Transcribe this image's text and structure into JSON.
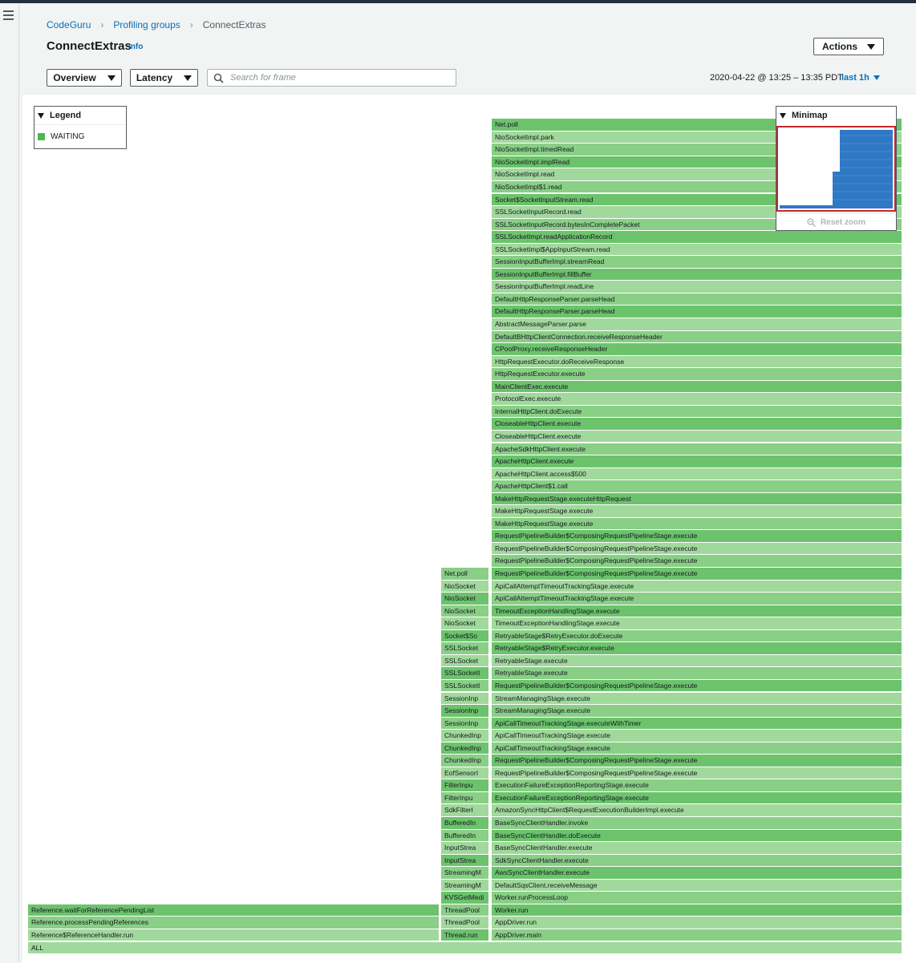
{
  "breadcrumb": {
    "root": "CodeGuru",
    "middle": "Profiling groups",
    "current": "ConnectExtras"
  },
  "page": {
    "title": "ConnectExtras",
    "info": "Info",
    "actions_label": "Actions"
  },
  "toolbar": {
    "view_select": "Overview",
    "metric_select": "Latency",
    "search_placeholder": "Search for frame",
    "time_range": "2020-04-22 @ 13:25 – 13:35 PDT",
    "time_select": "last 1h"
  },
  "legend": {
    "title": "Legend",
    "items": [
      {
        "label": "WAITING",
        "color": "#4fb84d"
      }
    ]
  },
  "minimap": {
    "title": "Minimap",
    "reset_label": "Reset zoom"
  },
  "flamegraph": {
    "colors": {
      "dark": "#6cc36c",
      "mid": "#89cf86",
      "light": "#a1d99c"
    },
    "root": "ALL",
    "left_stack": [
      "Reference$ReferenceHandler.run",
      "Reference.processPendingReferences",
      "Reference.waitForReferencePendingList"
    ],
    "middle_stack": [
      "Thread.run",
      "ThreadPool",
      "ThreadPool",
      "KVSGetMedi",
      "StreamingM",
      "StreamingM",
      "InputStrea",
      "InputStrea",
      "BufferedIn",
      "BufferedIn",
      "SdkFilterI",
      "FilterInpu",
      "FilterInpu",
      "EofSensorI",
      "ChunkedInp",
      "ChunkedInp",
      "ChunkedInp",
      "SessionInp",
      "SessionInp",
      "SessionInp",
      "SSLSocketI",
      "SSLSocketI",
      "SSLSocket",
      "SSLSocket",
      "Socket$So",
      "NioSocket",
      "NioSocket",
      "NioSocket",
      "NioSocket",
      "Net.poll"
    ],
    "right_stack": [
      "AppDriver.main",
      "AppDriver.run",
      "Worker.run",
      "Worker.runProcessLoop",
      "DefaultSqsClient.receiveMessage",
      "AwsSyncClientHandler.execute",
      "SdkSyncClientHandler.execute",
      "BaseSyncClientHandler.execute",
      "BaseSyncClientHandler.doExecute",
      "BaseSyncClientHandler.invoke",
      "AmazonSyncHttpClient$RequestExecutionBuilderImpl.execute",
      "ExecutionFailureExceptionReportingStage.execute",
      "ExecutionFailureExceptionReportingStage.execute",
      "RequestPipelineBuilder$ComposingRequestPipelineStage.execute",
      "RequestPipelineBuilder$ComposingRequestPipelineStage.execute",
      "ApiCallTimeoutTrackingStage.execute",
      "ApiCallTimeoutTrackingStage.execute",
      "ApiCallTimeoutTrackingStage.executeWithTimer",
      "StreamManagingStage.execute",
      "StreamManagingStage.execute",
      "RequestPipelineBuilder$ComposingRequestPipelineStage.execute",
      "RetryableStage.execute",
      "RetryableStage.execute",
      "RetryableStage$RetryExecutor.execute",
      "RetryableStage$RetryExecutor.doExecute",
      "TimeoutExceptionHandlingStage.execute",
      "TimeoutExceptionHandlingStage.execute",
      "ApiCallAttemptTimeoutTrackingStage.execute",
      "ApiCallAttemptTimeoutTrackingStage.execute",
      "RequestPipelineBuilder$ComposingRequestPipelineStage.execute",
      "RequestPipelineBuilder$ComposingRequestPipelineStage.execute",
      "RequestPipelineBuilder$ComposingRequestPipelineStage.execute",
      "RequestPipelineBuilder$ComposingRequestPipelineStage.execute",
      "MakeHttpRequestStage.execute",
      "MakeHttpRequestStage.execute",
      "MakeHttpRequestStage.executeHttpRequest",
      "ApacheHttpClient$1.call",
      "ApacheHttpClient.access$500",
      "ApacheHttpClient.execute",
      "ApacheSdkHttpClient.execute",
      "CloseableHttpClient.execute",
      "CloseableHttpClient.execute",
      "InternalHttpClient.doExecute",
      "ProtocolExec.execute",
      "MainClientExec.execute",
      "HttpRequestExecutor.execute",
      "HttpRequestExecutor.doReceiveResponse",
      "CPoolProxy.receiveResponseHeader",
      "DefaultBHttpClientConnection.receiveResponseHeader",
      "AbstractMessageParser.parse",
      "DefaultHttpResponseParser.parseHead",
      "DefaultHttpResponseParser.parseHead",
      "SessionInputBufferImpl.readLine",
      "SessionInputBufferImpl.fillBuffer",
      "SessionInputBufferImpl.streamRead",
      "SSLSocketImpl$AppInputStream.read",
      "SSLSocketImpl.readApplicationRecord",
      "SSLSocketInputRecord.bytesInCompletePacket",
      "SSLSocketInputRecord.read",
      "Socket$SocketInputStream.read",
      "NioSocketImpl$1.read",
      "NioSocketImpl.read",
      "NioSocketImpl.implRead",
      "NioSocketImpl.timedRead",
      "NioSocketImpl.park",
      "Net.poll"
    ]
  }
}
